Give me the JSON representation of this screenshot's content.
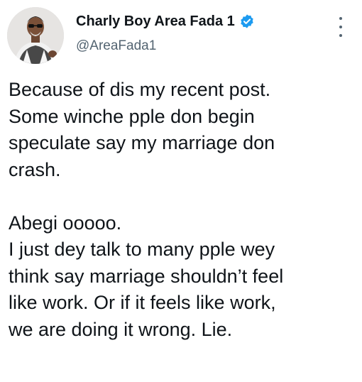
{
  "user": {
    "display_name": "Charly Boy Area Fada 1",
    "handle": "@AreaFada1",
    "verified": true
  },
  "tweet": {
    "paragraph_1": [
      "Because of dis my recent post.",
      "Some winche pple don begin",
      "speculate say my marriage don",
      "crash."
    ],
    "paragraph_2": [
      "Abegi ooooo.",
      "I just dey talk to many pple wey",
      "think say marriage shouldn’t feel",
      "like work.  Or if it feels like work,",
      "we are doing it wrong.  Lie."
    ]
  },
  "icons": {
    "verified_badge": "verified-badge-icon",
    "more_options": "more-options-icon"
  },
  "colors": {
    "text": "#0f1419",
    "secondary_text": "#536471",
    "verified_blue": "#1d9bf0",
    "background": "#ffffff"
  }
}
